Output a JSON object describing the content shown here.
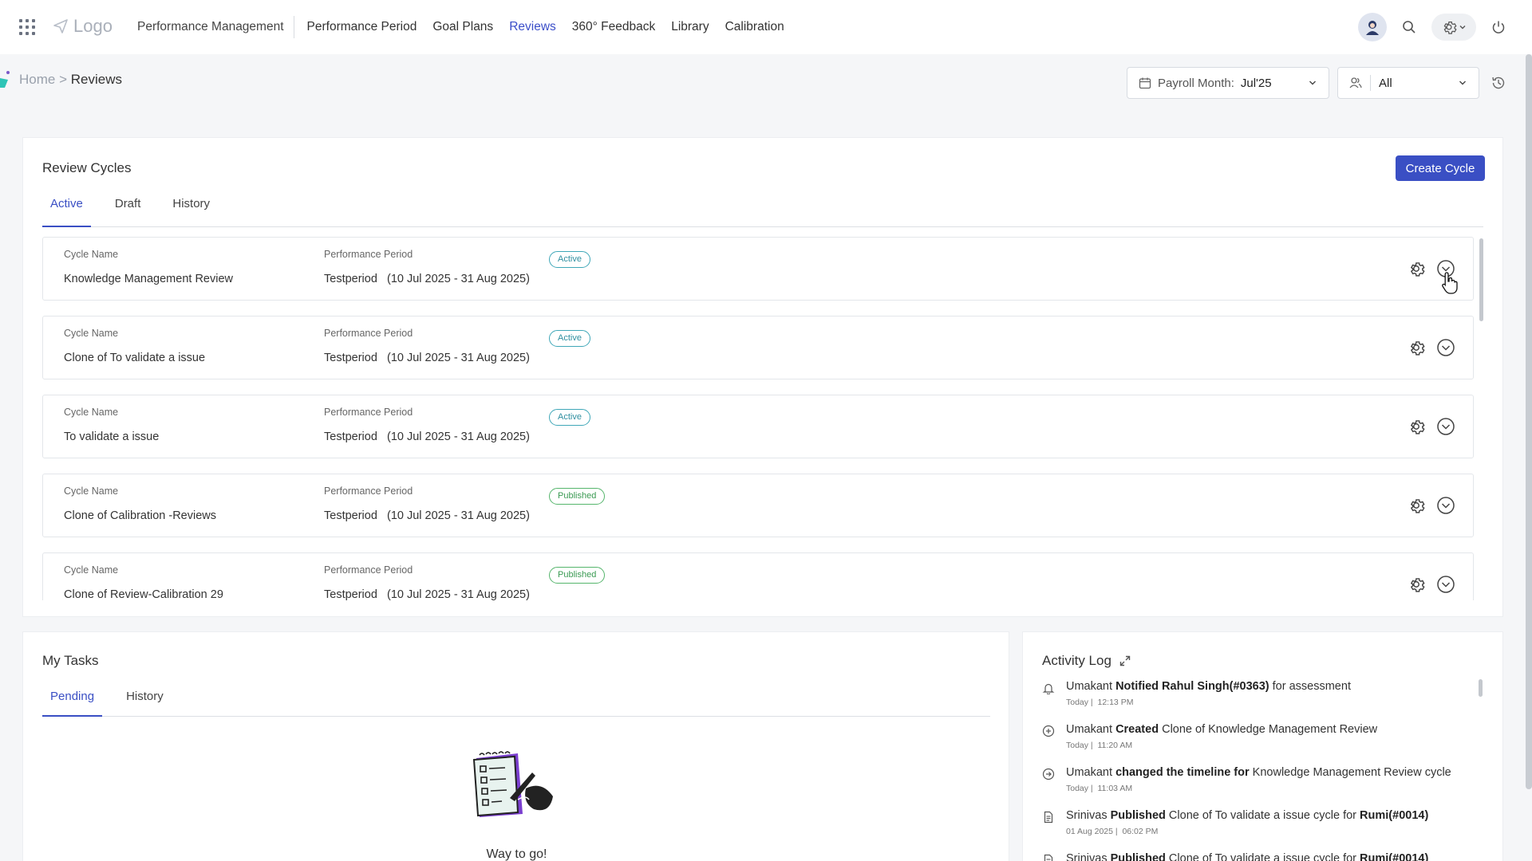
{
  "nav": {
    "logo": "Logo",
    "module": "Performance Management",
    "items": [
      "Performance Period",
      "Goal Plans",
      "Reviews",
      "360° Feedback",
      "Library",
      "Calibration"
    ],
    "active_index": 2
  },
  "breadcrumb": {
    "home": "Home",
    "sep": " > ",
    "current": "Reviews"
  },
  "filters": {
    "payroll_label": "Payroll Month:",
    "payroll_value": "Jul'25",
    "people_value": "All"
  },
  "review_cycles": {
    "title": "Review Cycles",
    "create_label": "Create Cycle",
    "tabs": [
      "Active",
      "Draft",
      "History"
    ],
    "col_cycle_label": "Cycle Name",
    "col_period_label": "Performance Period",
    "rows": [
      {
        "name": "Knowledge Management Review",
        "period": "Testperiod   (10 Jul 2025 - 31 Aug 2025)",
        "status": "Active"
      },
      {
        "name": "Clone of To validate a issue",
        "period": "Testperiod   (10 Jul 2025 - 31 Aug 2025)",
        "status": "Active"
      },
      {
        "name": "To validate a issue",
        "period": "Testperiod   (10 Jul 2025 - 31 Aug 2025)",
        "status": "Active"
      },
      {
        "name": "Clone of Calibration -Reviews",
        "period": "Testperiod   (10 Jul 2025 - 31 Aug 2025)",
        "status": "Published"
      },
      {
        "name": "Clone of Review-Calibration 29",
        "period": "Testperiod   (10 Jul 2025 - 31 Aug 2025)",
        "status": "Published"
      }
    ]
  },
  "tasks": {
    "title": "My Tasks",
    "tabs": [
      "Pending",
      "History"
    ],
    "empty_text": "Way to go!"
  },
  "activity_log": {
    "title": "Activity Log",
    "items": [
      {
        "icon": "bell-icon",
        "actor": "Umakant",
        "action": "Notified Rahul Singh(#0363)",
        "rest": " for assessment",
        "target": "",
        "time": "Today |  12:13 PM"
      },
      {
        "icon": "plus-circle-icon",
        "actor": "Umakant",
        "action": "Created",
        "rest": " Clone of Knowledge Management Review",
        "target": "",
        "time": "Today |  11:20 AM"
      },
      {
        "icon": "arrow-circle-icon",
        "actor": "Umakant",
        "action": "changed the timeline for",
        "rest": " Knowledge Management Review cycle",
        "target": "",
        "time": "Today |  11:03 AM"
      },
      {
        "icon": "document-icon",
        "actor": "Srinivas",
        "action": "Published",
        "rest": " Clone of To validate a issue cycle for ",
        "target": "Rumi(#0014)",
        "time": "01 Aug 2025 |  06:02 PM"
      },
      {
        "icon": "document-icon",
        "actor": "Srinivas",
        "action": "Published",
        "rest": " Clone of To validate a issue cycle for ",
        "target": "Rumi(#0014)",
        "time": ""
      }
    ]
  },
  "colors": {
    "accent": "#3a4fc4",
    "active_badge": "#3fa7b8",
    "published_badge": "#55b56c"
  }
}
